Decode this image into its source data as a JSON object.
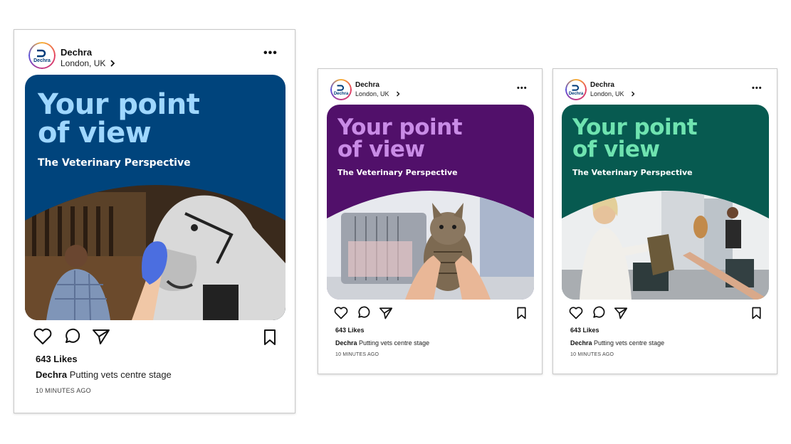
{
  "posts": [
    {
      "account_name": "Dechra",
      "location": "London, UK",
      "logo_text": "Dechra",
      "headline": "Your point\nof view",
      "subhead": "The Veterinary Perspective",
      "likes": "643 Likes",
      "caption_user": "Dechra",
      "caption_text": "Putting vets centre stage",
      "timestamp": "10 MINUTES AGO",
      "card_bg": "#00447c",
      "headline_color": "#9fd7ff",
      "photo_subject": "vet-with-horse"
    },
    {
      "account_name": "Dechra",
      "location": "London, UK",
      "logo_text": "Dechra",
      "headline": "Your point\nof view",
      "subhead": "The Veterinary Perspective",
      "likes": "643 Likes",
      "caption_user": "Dechra",
      "caption_text": "Putting vets centre stage",
      "timestamp": "10 MINUTES AGO",
      "card_bg": "#51106a",
      "headline_color": "#c98be6",
      "photo_subject": "cat-held-by-hands"
    },
    {
      "account_name": "Dechra",
      "location": "London, UK",
      "logo_text": "Dechra",
      "headline": "Your point\nof view",
      "subhead": "The Veterinary Perspective",
      "likes": "643 Likes",
      "caption_user": "Dechra",
      "caption_text": "Putting vets centre stage",
      "timestamp": "10 MINUTES AGO",
      "card_bg": "#075a50",
      "headline_color": "#6fe3b0",
      "photo_subject": "woman-in-waiting-room"
    }
  ],
  "icons": [
    "heart-icon",
    "comment-icon",
    "share-icon",
    "bookmark-icon",
    "more-icon",
    "chevron-right-icon"
  ]
}
